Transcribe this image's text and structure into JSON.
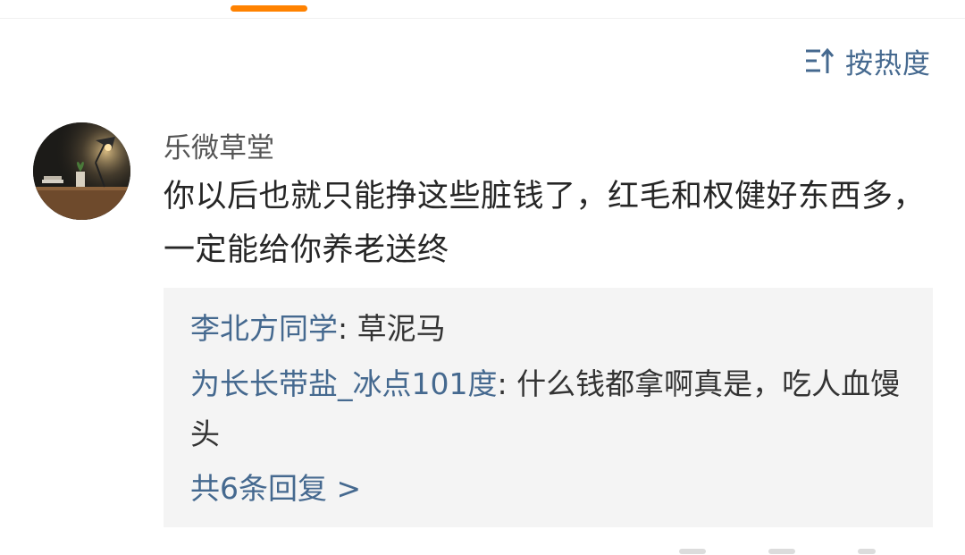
{
  "sort": {
    "label": "按热度",
    "icon": "sort-up-icon"
  },
  "comment": {
    "username": "乐微草堂",
    "text": "你以后也就只能挣这些脏钱了，红毛和权健好东西多，一定能给你养老送终",
    "avatar": "desk-lamp-avatar"
  },
  "replies": [
    {
      "name": "李北方同学",
      "separator": ": ",
      "text": "草泥马"
    },
    {
      "name": "为长长带盐_冰点101度",
      "separator": ": ",
      "text": "什么钱都拿啊真是，吃人血馒头"
    }
  ],
  "more_replies": "共6条回复 >",
  "colors": {
    "accent": "#ff8200",
    "link": "#45698f",
    "text": "#262626",
    "reply_bg": "#f4f4f4"
  }
}
